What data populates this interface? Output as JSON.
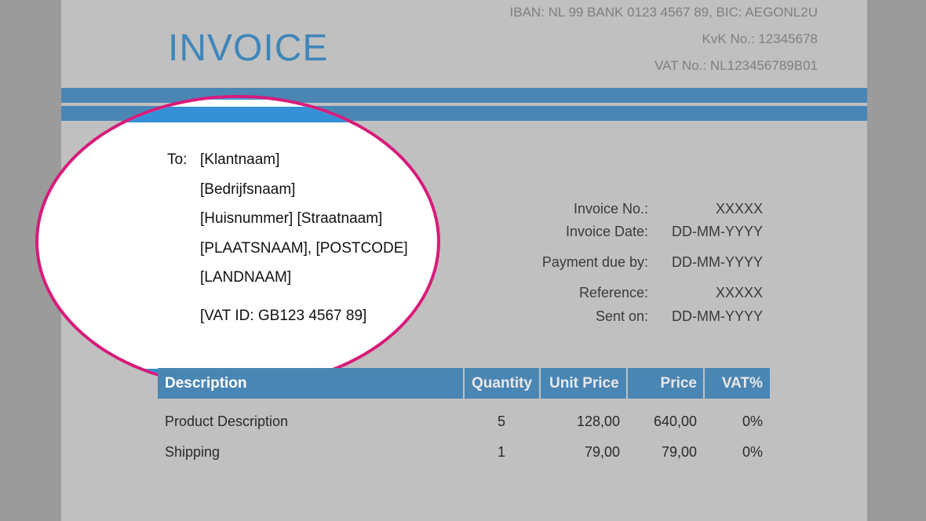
{
  "header": {
    "title": "INVOICE",
    "company": {
      "bank": "IBAN: NL 99 BANK 0123 4567 89, BIC: AEGONL2U",
      "kvk": "KvK No.: 12345678",
      "vat": "VAT No.: NL123456789B01"
    }
  },
  "recipient": {
    "to_label": "To:",
    "lines": [
      "[Klantnaam]",
      "[Bedrijfsnaam]",
      "[Huisnummer] [Straatnaam]",
      "[PLAATSNAAM], [POSTCODE]",
      "[LANDNAAM]"
    ],
    "vat_id": "[VAT ID: GB123 4567 89]"
  },
  "details": [
    {
      "label": "Invoice No.:",
      "value": "XXXXX"
    },
    {
      "label": "Invoice Date:",
      "value": "DD-MM-YYYY"
    },
    {
      "label": "Payment due by:",
      "value": "DD-MM-YYYY"
    },
    {
      "label": "Reference:",
      "value": "XXXXX"
    },
    {
      "label": "Sent on:",
      "value": "DD-MM-YYYY"
    }
  ],
  "table": {
    "headers": {
      "description": "Description",
      "quantity": "Quantity",
      "unit_price": "Unit Price",
      "price": "Price",
      "vat": "VAT%"
    },
    "rows": [
      {
        "description": "Product Description",
        "quantity": "5",
        "unit_price": "128,00",
        "price": "640,00",
        "vat": "0%"
      },
      {
        "description": "Shipping",
        "quantity": "1",
        "unit_price": "79,00",
        "price": "79,00",
        "vat": "0%"
      }
    ]
  },
  "colors": {
    "accent": "#4a86b4",
    "highlight": "#d81b7b"
  }
}
